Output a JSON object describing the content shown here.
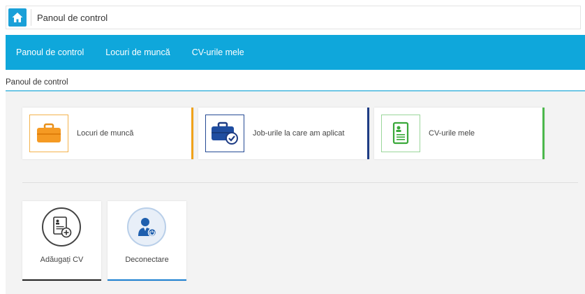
{
  "breadcrumb": {
    "home_icon": "home-icon",
    "title": "Panoul de control"
  },
  "nav": {
    "items": [
      {
        "label": "Panoul de control"
      },
      {
        "label": "Locuri de muncă"
      },
      {
        "label": "CV-urile mele"
      }
    ]
  },
  "section": {
    "title": "Panoul de control"
  },
  "cards": [
    {
      "label": "Locuri de muncă",
      "icon": "briefcase-icon",
      "accent": "#f0a21a"
    },
    {
      "label": "Job-urile la care am aplicat",
      "icon": "briefcase-check-icon",
      "accent": "#1e3c84"
    },
    {
      "label": "CV-urile mele",
      "icon": "cv-document-icon",
      "accent": "#4cb84c"
    }
  ],
  "actions": [
    {
      "label": "Adăugați CV",
      "icon": "add-cv-icon",
      "accent": "#222222"
    },
    {
      "label": "Deconectare",
      "icon": "user-logout-icon",
      "accent": "#1a7fd0"
    }
  ],
  "colors": {
    "nav_bg": "#0fa7db",
    "home_bg": "#1aa0d8"
  }
}
